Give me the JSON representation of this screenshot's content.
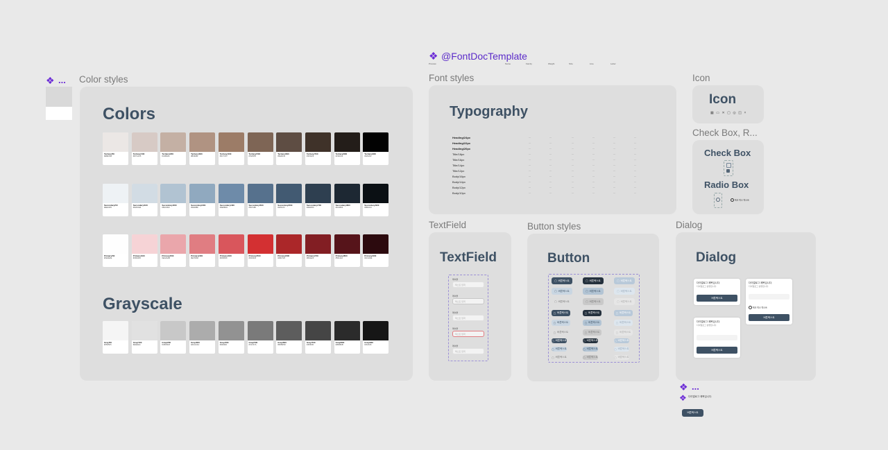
{
  "canvas": {
    "left_component": {
      "icon": "component-icon",
      "ellipsis": "..."
    },
    "color_styles": {
      "label": "Color styles",
      "title": "Colors",
      "grayscale_title": "Grayscale",
      "rows": [
        {
          "name": "Tertiary",
          "swatches": [
            "#ebe7e5",
            "#d7cac5",
            "#c4b0a4",
            "#b09382",
            "#9c7c67",
            "#7e6555",
            "#5e4d43",
            "#3f3229",
            "#231d19",
            "#020202"
          ]
        },
        {
          "name": "Secondary",
          "swatches": [
            "#eef2f5",
            "#d2dce4",
            "#b1c3d2",
            "#90a9bf",
            "#6e8ba9",
            "#56718d",
            "#425a72",
            "#2e3f50",
            "#1d2833",
            "#0b1014"
          ]
        },
        {
          "name": "Primary",
          "swatches": [
            "#fefefe",
            "#f6d3d6",
            "#eaa6ab",
            "#e07d82",
            "#d9565c",
            "#d33032",
            "#ab2729",
            "#821e23",
            "#56141a",
            "#2c0a0e"
          ]
        },
        {
          "name": "Gray",
          "swatches": [
            "#f5f5f5",
            "#e1e1e1",
            "#c8c8c8",
            "#acacac",
            "#929292",
            "#7a7a7a",
            "#5d5d5d",
            "#454545",
            "#2b2b2b",
            "#161616"
          ]
        }
      ]
    },
    "font_doc": {
      "icon": "component-icon",
      "label": "@FontDocTemplate",
      "columns": [
        "Preview",
        "Name",
        "Family",
        "Weight",
        "Size",
        "Line",
        "Letter",
        "Spacing"
      ]
    },
    "font_styles": {
      "label": "Font styles",
      "title": "Typography",
      "rows": [
        {
          "name": "Heading/24px",
          "bold": true
        },
        {
          "name": "Heading/22px",
          "bold": true
        },
        {
          "name": "Heading/20px",
          "bold": true
        },
        {
          "name": "Title/18px",
          "bold": false
        },
        {
          "name": "Title/16px",
          "bold": false
        },
        {
          "name": "Title/14px",
          "bold": false
        },
        {
          "name": "Title/12px",
          "bold": false
        },
        {
          "name": "Body/16px",
          "bold": false
        },
        {
          "name": "Body/14px",
          "bold": false
        },
        {
          "name": "Body/12px",
          "bold": false
        },
        {
          "name": "Body/10px",
          "bold": false
        }
      ]
    },
    "icon_frame": {
      "label": "Icon",
      "title": "Icon"
    },
    "check_box": {
      "label": "Check Box, R...",
      "title_check": "Check Box",
      "title_radio": "Radio Box",
      "radio_text": "체크 박스 텍스트"
    },
    "textfield": {
      "label": "TextField",
      "title": "TextField",
      "field_label": "레이블",
      "placeholder": "텍스트 입력",
      "value": "텍스트 입력"
    },
    "button_styles": {
      "label": "Button styles",
      "title": "Button",
      "button_text": "버튼텍스트"
    },
    "dialog": {
      "label": "Dialog",
      "title": "Dialog",
      "dialog_title": "다이얼로그 제목입니다.",
      "dialog_sub": "다이얼로그 설명입니다.",
      "button_text": "버튼텍스트",
      "check_text": "체크 박스 텍스트"
    },
    "bottom_component": {
      "ellipsis": "...",
      "mini_text": "다이얼로그 제목입니다.",
      "button_text": "버튼텍스트"
    }
  }
}
